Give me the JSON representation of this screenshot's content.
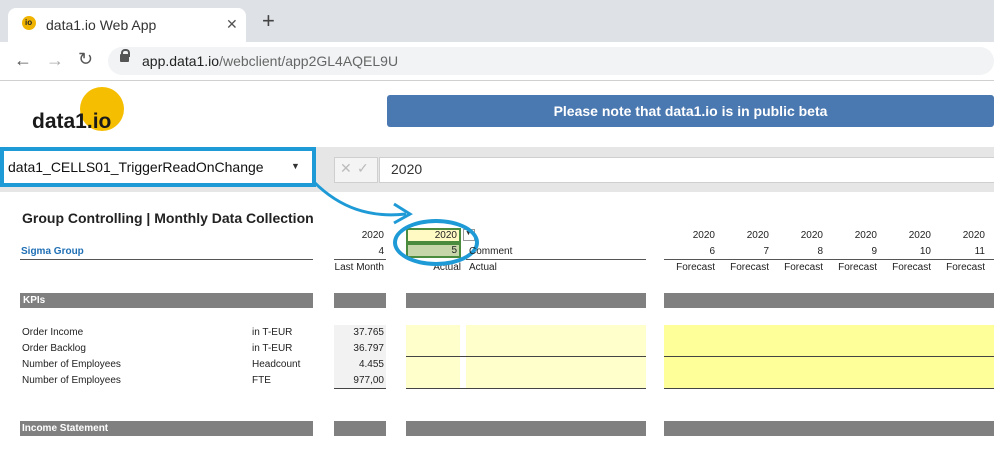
{
  "browser": {
    "tab_title": "data1.io Web App",
    "favicon_text": "io",
    "close_glyph": "✕",
    "new_tab_glyph": "+",
    "back_glyph": "←",
    "forward_glyph": "→",
    "reload_glyph": "↻",
    "url_domain": "app.data1.io",
    "url_path": "/webclient/app2GL4AQEL9U"
  },
  "header": {
    "logo_text": "data1.io",
    "banner": "Please note that data1.io is in public beta"
  },
  "toolbar": {
    "namebox_value": "data1_CELLS01_TriggerReadOnChange",
    "namebox_arrow": "▼",
    "cancel_glyph": "✕",
    "confirm_glyph": "✓",
    "formula_value": "2020"
  },
  "sheet": {
    "title": "Group Controlling | Monthly Data Collection",
    "entity": "Sigma Group",
    "col_last_month": {
      "year": "2020",
      "month": "4",
      "label": "Last Month"
    },
    "col_selected": {
      "year": "2020",
      "month": "5",
      "label": "Actual"
    },
    "dropdown_arrow": "▼",
    "col_comment": {
      "label": "Comment",
      "sub": "Actual"
    },
    "forecast_cols": [
      {
        "year": "2020",
        "month": "6",
        "label": "Forecast"
      },
      {
        "year": "2020",
        "month": "7",
        "label": "Forecast"
      },
      {
        "year": "2020",
        "month": "8",
        "label": "Forecast"
      },
      {
        "year": "2020",
        "month": "9",
        "label": "Forecast"
      },
      {
        "year": "2020",
        "month": "10",
        "label": "Forecast"
      },
      {
        "year": "2020",
        "month": "11",
        "label": "Forecast"
      }
    ],
    "section_kpis": "KPIs",
    "rows": [
      {
        "name": "Order Income",
        "unit": "in T-EUR",
        "value": "37.765"
      },
      {
        "name": "Order Backlog",
        "unit": "in T-EUR",
        "value": "36.797"
      },
      {
        "name": "Number of Employees",
        "unit": "Headcount",
        "value": "4.455"
      },
      {
        "name": "Number of Employees",
        "unit": "FTE",
        "value": "977,00"
      }
    ],
    "section_income": "Income Statement"
  },
  "colors": {
    "highlight": "#1e9ad6",
    "banner": "#4a78b0",
    "logo": "#f6be00",
    "section_bar": "#808080"
  }
}
